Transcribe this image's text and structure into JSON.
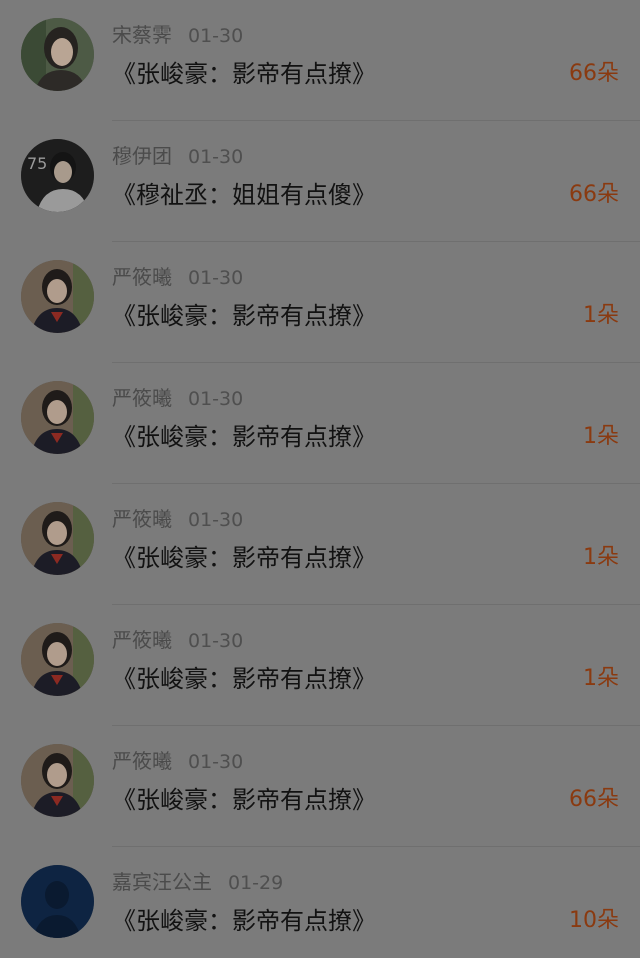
{
  "accent_color": "#8a3a10",
  "entries": [
    {
      "name": "宋蔡霁",
      "date": "01-30",
      "title": "《张峻豪：影帝有点撩》",
      "gift": "66朵",
      "avatar": "girl-green-background"
    },
    {
      "name": "穆伊团",
      "date": "01-30",
      "title": "《穆祉丞：姐姐有点傻》",
      "gift": "66朵",
      "avatar": "boy-dark-background"
    },
    {
      "name": "严筱曦",
      "date": "01-30",
      "title": "《张峻豪：影帝有点撩》",
      "gift": "1朵",
      "avatar": "girl-sailor-uniform"
    },
    {
      "name": "严筱曦",
      "date": "01-30",
      "title": "《张峻豪：影帝有点撩》",
      "gift": "1朵",
      "avatar": "girl-sailor-uniform"
    },
    {
      "name": "严筱曦",
      "date": "01-30",
      "title": "《张峻豪：影帝有点撩》",
      "gift": "1朵",
      "avatar": "girl-sailor-uniform"
    },
    {
      "name": "严筱曦",
      "date": "01-30",
      "title": "《张峻豪：影帝有点撩》",
      "gift": "1朵",
      "avatar": "girl-sailor-uniform"
    },
    {
      "name": "严筱曦",
      "date": "01-30",
      "title": "《张峻豪：影帝有点撩》",
      "gift": "66朵",
      "avatar": "girl-sailor-uniform"
    },
    {
      "name": "嘉宾汪公主",
      "date": "01-29",
      "title": "《张峻豪：影帝有点撩》",
      "gift": "10朵",
      "avatar": "dark-blue-silhouette"
    }
  ]
}
